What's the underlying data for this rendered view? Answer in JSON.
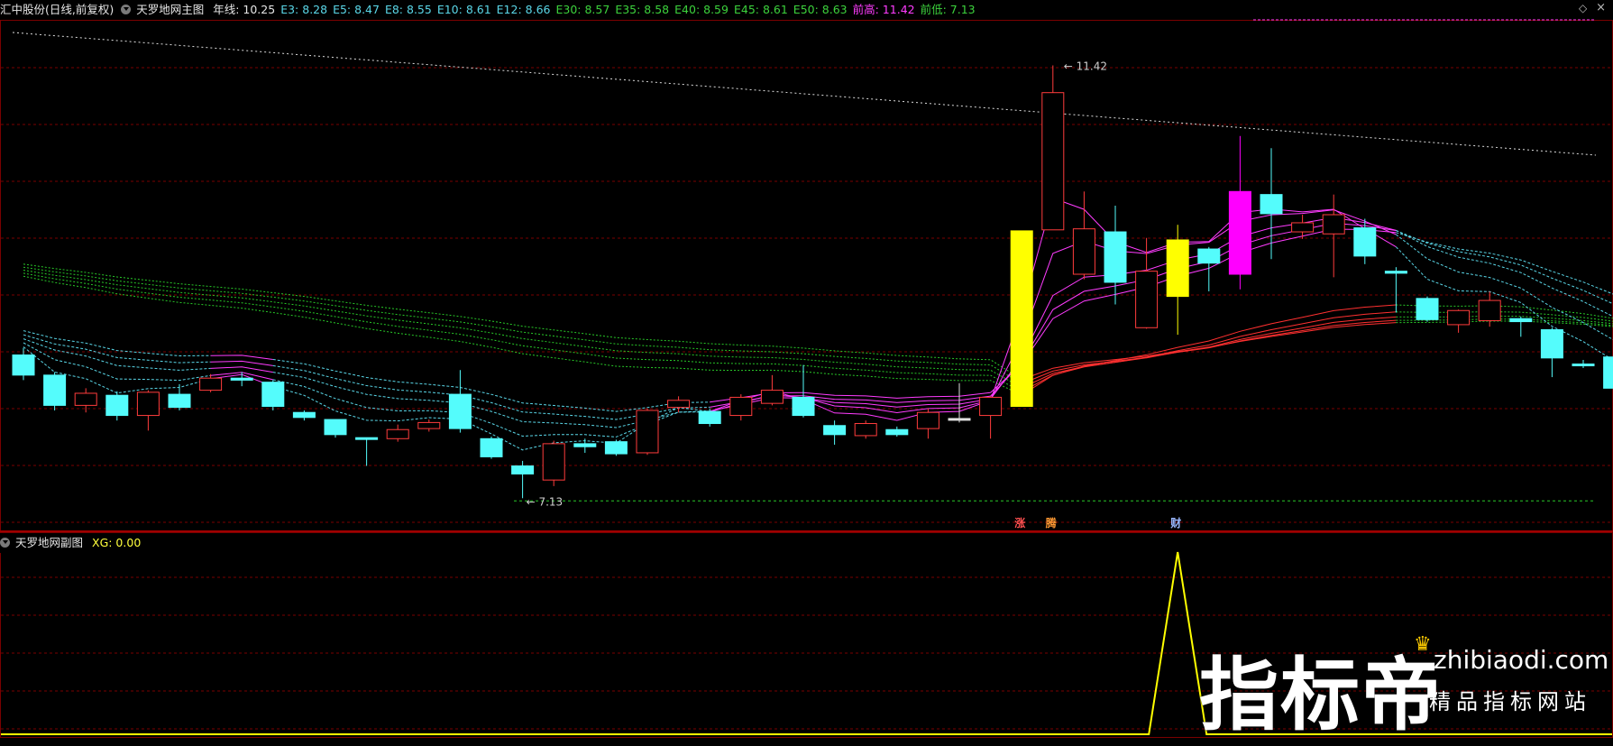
{
  "main_header": {
    "stock": "汇中股份(日线,前复权)",
    "indicator": "天罗地网主图",
    "items": [
      {
        "label": "年线: 10.25",
        "color": "#e6e6e6"
      },
      {
        "label": "E3: 8.28",
        "color": "#5ad7e8"
      },
      {
        "label": "E5: 8.47",
        "color": "#5ad7e8"
      },
      {
        "label": "E8: 8.55",
        "color": "#5ad7e8"
      },
      {
        "label": "E10: 8.61",
        "color": "#5ad7e8"
      },
      {
        "label": "E12: 8.66",
        "color": "#5ad7e8"
      },
      {
        "label": "E30: 8.57",
        "color": "#3cd23c"
      },
      {
        "label": "E35: 8.58",
        "color": "#3cd23c"
      },
      {
        "label": "E40: 8.59",
        "color": "#3cd23c"
      },
      {
        "label": "E45: 8.61",
        "color": "#3cd23c"
      },
      {
        "label": "E50: 8.63",
        "color": "#3cd23c"
      },
      {
        "label": "前高: 11.42",
        "color": "#ff3cff"
      },
      {
        "label": "前低: 7.13",
        "color": "#3cd23c"
      }
    ]
  },
  "sub_header": {
    "indicator": "天罗地网副图",
    "value": "XG: 0.00",
    "value_color": "#ffff3c"
  },
  "chart_annotations": {
    "high_label": "11.42",
    "low_label": "7.13",
    "markers": [
      "涨",
      "腾",
      "财"
    ]
  },
  "chart_data": {
    "type": "candlestick",
    "y_range": [
      6.9,
      11.8
    ],
    "prev_high": 11.42,
    "prev_low": 7.13,
    "candles": [
      {
        "o": 8.35,
        "c": 8.55,
        "h": 8.62,
        "l": 8.3,
        "col": "cyan"
      },
      {
        "o": 8.35,
        "c": 8.05,
        "h": 8.38,
        "l": 8.0,
        "col": "cyan"
      },
      {
        "o": 8.05,
        "c": 8.17,
        "h": 8.22,
        "l": 7.98,
        "col": "red"
      },
      {
        "o": 8.15,
        "c": 7.95,
        "h": 8.19,
        "l": 7.9,
        "col": "cyan"
      },
      {
        "o": 7.95,
        "c": 8.18,
        "h": 8.2,
        "l": 7.8,
        "col": "red"
      },
      {
        "o": 8.03,
        "c": 8.16,
        "h": 8.26,
        "l": 8.0,
        "col": "cyan"
      },
      {
        "o": 8.2,
        "c": 8.32,
        "h": 8.36,
        "l": 8.18,
        "col": "red"
      },
      {
        "o": 8.3,
        "c": 8.32,
        "h": 8.38,
        "l": 8.24,
        "col": "cyan"
      },
      {
        "o": 8.28,
        "c": 8.04,
        "h": 8.3,
        "l": 8.0,
        "col": "cyan"
      },
      {
        "o": 7.93,
        "c": 7.98,
        "h": 8.0,
        "l": 7.9,
        "col": "cyan"
      },
      {
        "o": 7.91,
        "c": 7.76,
        "h": 7.91,
        "l": 7.73,
        "col": "cyan"
      },
      {
        "o": 7.72,
        "c": 7.73,
        "h": 7.73,
        "l": 7.45,
        "col": "cyan"
      },
      {
        "o": 7.72,
        "c": 7.81,
        "h": 7.86,
        "l": 7.69,
        "col": "red"
      },
      {
        "o": 7.82,
        "c": 7.88,
        "h": 7.91,
        "l": 7.79,
        "col": "red"
      },
      {
        "o": 8.16,
        "c": 7.82,
        "h": 8.4,
        "l": 7.78,
        "col": "cyan"
      },
      {
        "o": 7.72,
        "c": 7.54,
        "h": 7.74,
        "l": 7.52,
        "col": "cyan"
      },
      {
        "o": 7.45,
        "c": 7.37,
        "h": 7.5,
        "l": 7.13,
        "col": "cyan"
      },
      {
        "o": 7.31,
        "c": 7.67,
        "h": 7.7,
        "l": 7.25,
        "col": "red"
      },
      {
        "o": 7.67,
        "c": 7.64,
        "h": 7.72,
        "l": 7.58,
        "col": "cyan"
      },
      {
        "o": 7.69,
        "c": 7.57,
        "h": 7.71,
        "l": 7.55,
        "col": "cyan"
      },
      {
        "o": 7.58,
        "c": 8.0,
        "h": 8.02,
        "l": 7.56,
        "col": "red"
      },
      {
        "o": 8.03,
        "c": 8.1,
        "h": 8.14,
        "l": 7.98,
        "col": "red"
      },
      {
        "o": 7.99,
        "c": 7.87,
        "h": 8.02,
        "l": 7.84,
        "col": "cyan"
      },
      {
        "o": 7.95,
        "c": 8.13,
        "h": 8.16,
        "l": 7.9,
        "col": "red"
      },
      {
        "o": 8.07,
        "c": 8.2,
        "h": 8.35,
        "l": 8.05,
        "col": "red"
      },
      {
        "o": 8.13,
        "c": 7.95,
        "h": 8.45,
        "l": 7.93,
        "col": "cyan"
      },
      {
        "o": 7.85,
        "c": 7.76,
        "h": 7.9,
        "l": 7.66,
        "col": "cyan"
      },
      {
        "o": 7.75,
        "c": 7.87,
        "h": 7.9,
        "l": 7.72,
        "col": "red"
      },
      {
        "o": 7.81,
        "c": 7.76,
        "h": 7.84,
        "l": 7.74,
        "col": "cyan"
      },
      {
        "o": 7.82,
        "c": 7.98,
        "h": 8.02,
        "l": 7.72,
        "col": "red"
      },
      {
        "o": 7.91,
        "c": 7.92,
        "h": 8.27,
        "l": 7.88,
        "col": "white"
      },
      {
        "o": 7.95,
        "c": 8.13,
        "h": 8.14,
        "l": 7.72,
        "col": "red"
      },
      {
        "o": 8.04,
        "c": 9.78,
        "h": 9.78,
        "l": 8.04,
        "col": "yellow"
      },
      {
        "o": 9.79,
        "c": 11.15,
        "h": 11.42,
        "l": 9.79,
        "col": "red"
      },
      {
        "o": 9.35,
        "c": 9.8,
        "h": 10.17,
        "l": 9.3,
        "col": "red"
      },
      {
        "o": 9.77,
        "c": 9.27,
        "h": 10.03,
        "l": 9.05,
        "col": "cyan"
      },
      {
        "o": 8.82,
        "c": 9.38,
        "h": 9.71,
        "l": 8.81,
        "col": "red"
      },
      {
        "o": 9.13,
        "c": 9.69,
        "h": 9.84,
        "l": 8.75,
        "col": "yellow"
      },
      {
        "o": 9.46,
        "c": 9.6,
        "h": 9.62,
        "l": 9.18,
        "col": "cyan"
      },
      {
        "o": 9.35,
        "c": 10.17,
        "h": 10.72,
        "l": 9.2,
        "col": "magenta"
      },
      {
        "o": 10.14,
        "c": 9.95,
        "h": 10.6,
        "l": 9.5,
        "col": "cyan"
      },
      {
        "o": 9.77,
        "c": 9.86,
        "h": 9.94,
        "l": 9.7,
        "col": "red"
      },
      {
        "o": 9.75,
        "c": 9.94,
        "h": 10.14,
        "l": 9.32,
        "col": "red"
      },
      {
        "o": 9.81,
        "c": 9.53,
        "h": 9.9,
        "l": 9.45,
        "col": "cyan"
      },
      {
        "o": 9.38,
        "c": 9.36,
        "h": 9.42,
        "l": 8.97,
        "col": "cyan"
      },
      {
        "o": 9.11,
        "c": 8.9,
        "h": 9.13,
        "l": 8.88,
        "col": "cyan"
      },
      {
        "o": 8.85,
        "c": 8.99,
        "h": 9.0,
        "l": 8.77,
        "col": "red"
      },
      {
        "o": 8.89,
        "c": 9.09,
        "h": 9.18,
        "l": 8.83,
        "col": "red"
      },
      {
        "o": 8.91,
        "c": 8.88,
        "h": 8.93,
        "l": 8.73,
        "col": "cyan"
      },
      {
        "o": 8.8,
        "c": 8.52,
        "h": 8.82,
        "l": 8.33,
        "col": "cyan"
      },
      {
        "o": 8.46,
        "c": 8.45,
        "h": 8.5,
        "l": 8.42,
        "col": "cyan"
      },
      {
        "o": 8.53,
        "c": 8.22,
        "h": 8.55,
        "l": 8.2,
        "col": "cyan"
      }
    ],
    "sub_series": {
      "name": "XG",
      "values_on_index": {
        "37": 1
      }
    }
  }
}
